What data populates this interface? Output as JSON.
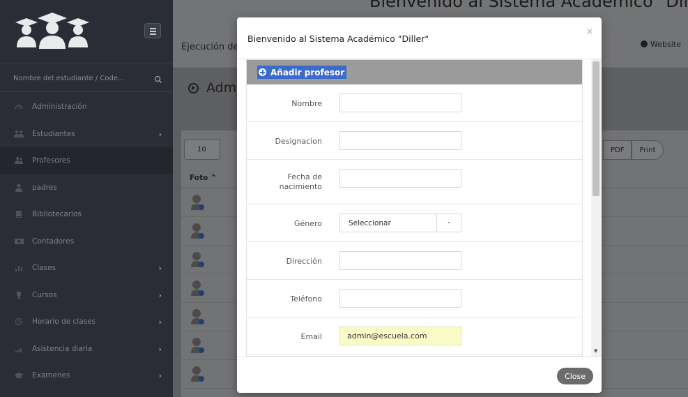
{
  "colors": {
    "sidebar_bg": "#2a2d35",
    "accent_selection": "#3b6ac9",
    "autofill_bg": "#fafcc8",
    "close_button": "#6b6b6b"
  },
  "sidebar": {
    "search_placeholder": "Nombre del estudiante / Code...",
    "items": [
      {
        "label": "Administración",
        "icon": "dashboard-icon",
        "has_submenu": false
      },
      {
        "label": "Estudiantes",
        "icon": "users-group-icon",
        "has_submenu": true
      },
      {
        "label": "Profesores",
        "icon": "user-pair-icon",
        "has_submenu": false,
        "active": true
      },
      {
        "label": "padres",
        "icon": "user-icon",
        "has_submenu": false
      },
      {
        "label": "Bibliotecarios",
        "icon": "book-icon",
        "has_submenu": false
      },
      {
        "label": "Contadores",
        "icon": "money-icon",
        "has_submenu": false
      },
      {
        "label": "Clases",
        "icon": "chart-bar-icon",
        "has_submenu": true
      },
      {
        "label": "Cursos",
        "icon": "cup-icon",
        "has_submenu": true
      },
      {
        "label": "Horario de clases",
        "icon": "clock-icon",
        "has_submenu": true
      },
      {
        "label": "Asistencia diaria",
        "icon": "signal-icon",
        "has_submenu": true
      },
      {
        "label": "Examenes",
        "icon": "graduation-icon",
        "has_submenu": true
      }
    ]
  },
  "topbar": {
    "site_title": "Bienvenido al Sistema Académico \"Diller\"",
    "subtitle": "Ejecución de",
    "website_link": "Website"
  },
  "page": {
    "heading": "Adm",
    "length_value": "10",
    "export_buttons": [
      "PDF",
      "Print"
    ],
    "column_foto": "Foto"
  },
  "modal": {
    "title": "Bienvenido al Sistema Académico \"Diller\"",
    "close_x": "×",
    "form_header": "Añadir profesor",
    "fields": {
      "nombre": {
        "label": "Nombre",
        "value": ""
      },
      "designacion": {
        "label": "Designacion",
        "value": ""
      },
      "fecha_nacimiento": {
        "label": "Fecha de nacimiento",
        "value": ""
      },
      "genero": {
        "label": "Género",
        "selected": "Seleccionar"
      },
      "direccion": {
        "label": "Dirección",
        "value": ""
      },
      "telefono": {
        "label": "Teléfono",
        "value": ""
      },
      "email": {
        "label": "Email",
        "value": "admin@escuela.com"
      }
    },
    "close_button": "Close"
  }
}
